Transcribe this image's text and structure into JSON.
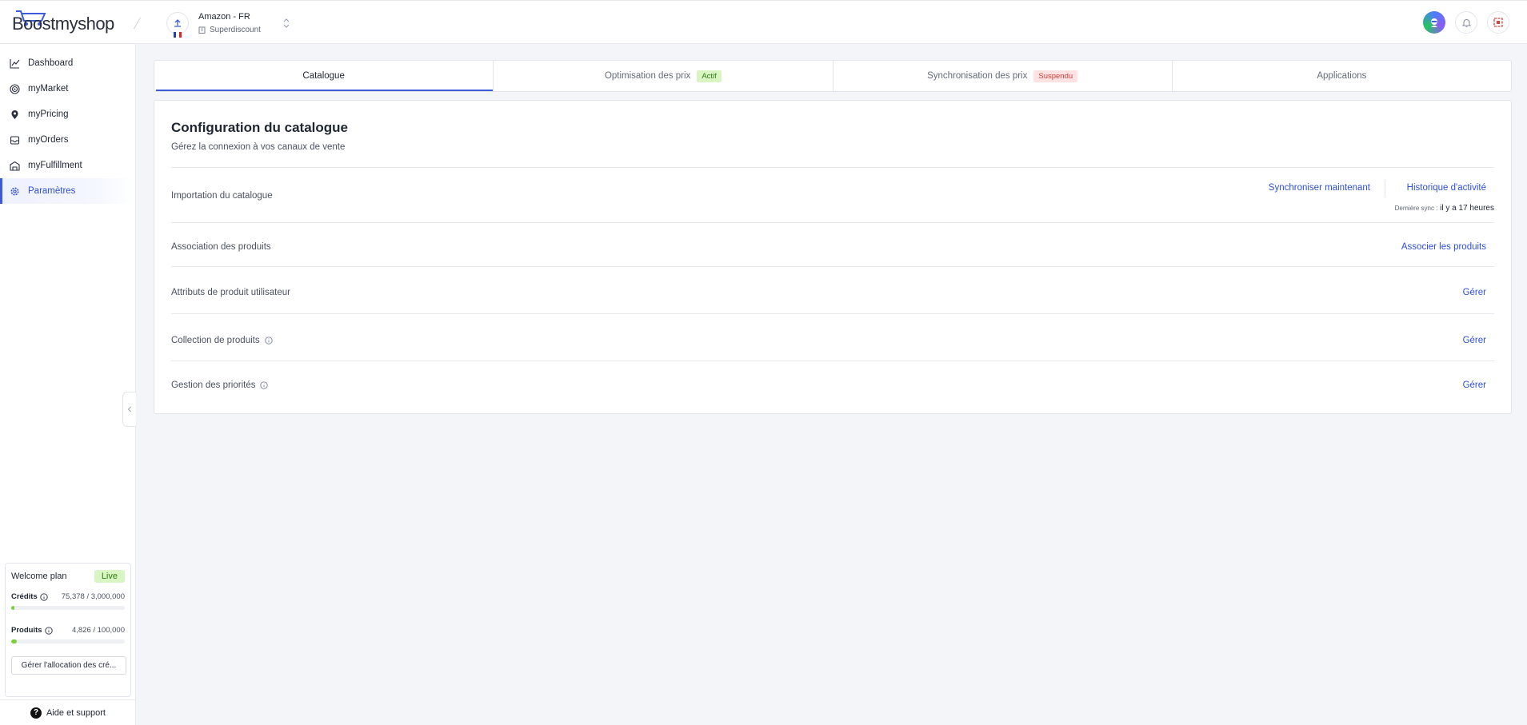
{
  "brand": {
    "logo_text": "Boostmyshop",
    "accent": "#3b5bdb",
    "success": "#7ccf3f"
  },
  "header": {
    "store_name": "Amazon - FR",
    "store_sub": "Superdiscount",
    "icons": [
      "avatar-icon",
      "bell-icon",
      "shop-icon"
    ]
  },
  "sidebar": {
    "items": [
      {
        "label": "Dashboard",
        "icon": "chart-line-icon"
      },
      {
        "label": "myMarket",
        "icon": "radar-icon"
      },
      {
        "label": "myPricing",
        "icon": "location-pin-icon"
      },
      {
        "label": "myOrders",
        "icon": "inbox-icon"
      },
      {
        "label": "myFulfillment",
        "icon": "warehouse-icon"
      },
      {
        "label": "Paramètres",
        "icon": "gear-icon",
        "active": true
      }
    ],
    "plan": {
      "name": "Welcome plan",
      "status": "Live",
      "credits_label": "Crédits",
      "credits_value": "75,378 / 3,000,000",
      "credits_fraction": 0.025,
      "products_label": "Produits",
      "products_value": "4,826 / 100,000",
      "products_fraction": 0.048,
      "manage_button": "Gérer l'allocation des cré..."
    },
    "help_label": "Aide et support"
  },
  "tabs": [
    {
      "label": "Catalogue",
      "active": true
    },
    {
      "label": "Optimisation des prix",
      "badge": "Actif"
    },
    {
      "label": "Synchronisation des prix",
      "badge": "Suspendu"
    },
    {
      "label": "Applications"
    }
  ],
  "panel": {
    "title": "Configuration du catalogue",
    "subtitle": "Gérez la connexion à vos canaux de vente",
    "rows": [
      {
        "label": "Importation du catalogue",
        "actions": [
          "Synchroniser maintenant",
          "Historique d'activité"
        ],
        "meta_label": "Dernière sync :",
        "meta_value": "il y a 17 heures"
      },
      {
        "label": "Association des produits",
        "action": "Associer les produits"
      },
      {
        "label": "Attributs de produit utilisateur",
        "action": "Gérer"
      },
      {
        "label": "Collection de produits",
        "action": "Gérer",
        "info": true
      },
      {
        "label": "Gestion des priorités",
        "action": "Gérer",
        "info": true
      }
    ]
  }
}
